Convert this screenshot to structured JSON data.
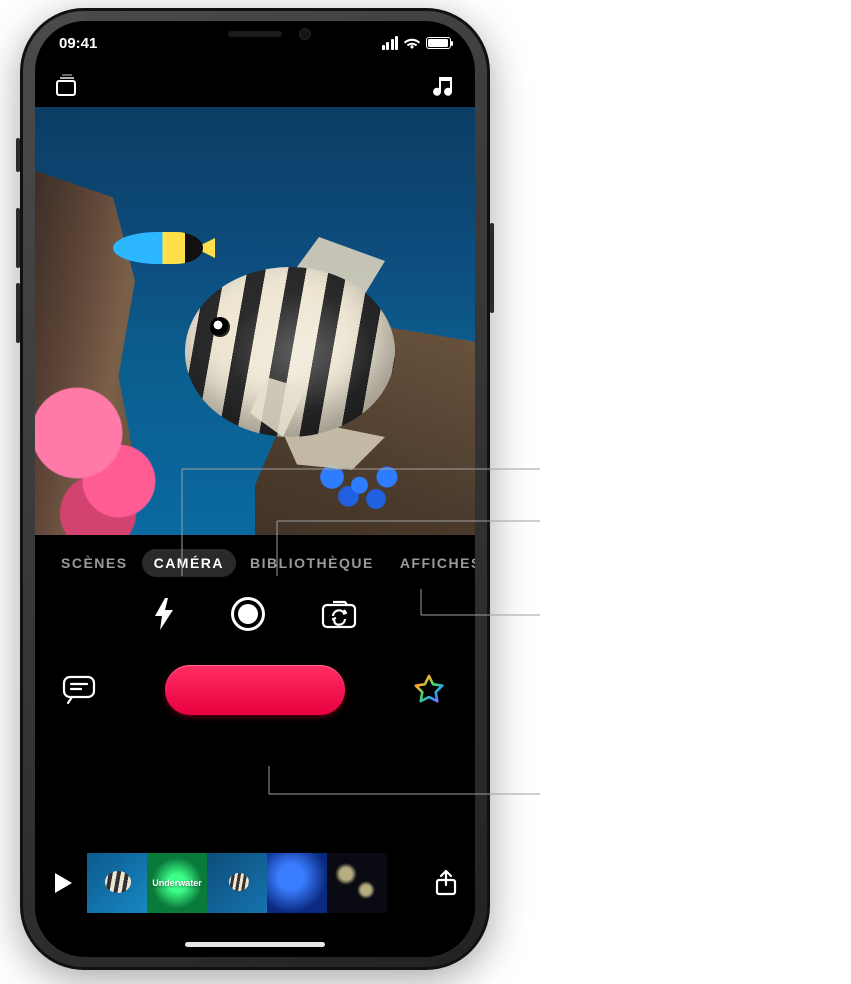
{
  "status": {
    "time": "09:41"
  },
  "nav": {
    "projects_icon": "projects-stack-icon",
    "music_icon": "music-note-icon"
  },
  "tabs": {
    "scenes": "SCÈNES",
    "camera": "CAMÉRA",
    "library": "BIBLIOTHÈQUE",
    "posters": "AFFICHES",
    "active": "camera"
  },
  "camera_controls": {
    "flash": "flash-icon",
    "shutter": "shutter-icon",
    "flip": "flip-camera-icon"
  },
  "record_row": {
    "live_titles": "live-titles-icon",
    "record": "record-button",
    "effects": "effects-star-icon"
  },
  "timeline": {
    "play": "play-icon",
    "share": "share-icon",
    "clip2_label": "Underwater"
  }
}
